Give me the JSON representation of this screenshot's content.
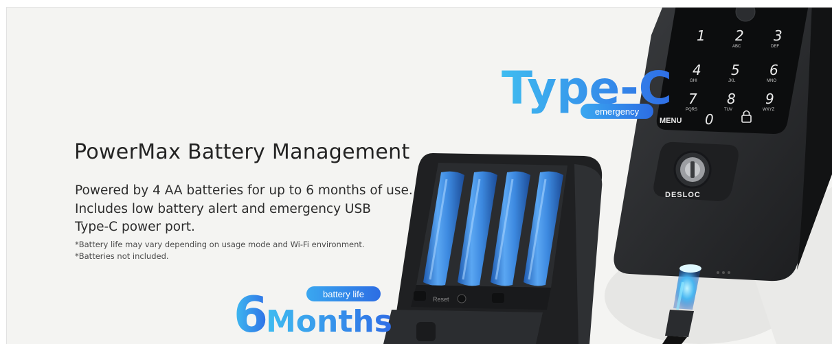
{
  "heading": "PowerMax Battery Management",
  "body_lines": [
    "Powered by 4 AA batteries for up to 6 months of use.",
    "Includes low battery alert and emergency USB",
    "Type-C power port."
  ],
  "notes": [
    "*Battery life may vary depending on usage mode and Wi-Fi environment.",
    "*Batteries not included."
  ],
  "type_c": {
    "title": "Type-C",
    "badge": "emergency"
  },
  "months": {
    "number": "6",
    "word": "Months",
    "badge": "battery life"
  },
  "lock": {
    "brand": "DESLOC",
    "keys": [
      {
        "digit": "1",
        "letters": ""
      },
      {
        "digit": "2",
        "letters": "ABC"
      },
      {
        "digit": "3",
        "letters": "DEF"
      },
      {
        "digit": "4",
        "letters": "GHI"
      },
      {
        "digit": "5",
        "letters": "JKL"
      },
      {
        "digit": "6",
        "letters": "MNO"
      },
      {
        "digit": "7",
        "letters": "PQRS"
      },
      {
        "digit": "8",
        "letters": "TUV"
      },
      {
        "digit": "9",
        "letters": "WXYZ"
      }
    ],
    "menu_label": "MENU",
    "zero_label": "0",
    "reset_label": "Reset"
  },
  "colors": {
    "background": "#f4f4f2",
    "accent_blue": "#2f7fe8",
    "accent_cyan": "#3fbcf0",
    "device_dark": "#222426",
    "battery_blue": "#3d8ae0"
  },
  "icons": [
    "lock-icon",
    "key-cylinder-icon",
    "usb-c-cable-icon",
    "aa-battery-icon"
  ]
}
